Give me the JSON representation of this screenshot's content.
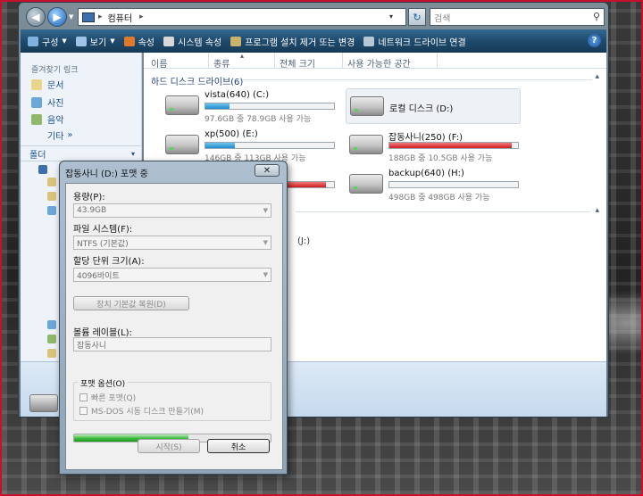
{
  "explorer": {
    "address": {
      "crumb": "컴퓨터",
      "sep": "▸",
      "crumbsep": "▸",
      "dropdown": "▾"
    },
    "search_placeholder": "검색",
    "toolbar": [
      {
        "label": "구성",
        "icon": "organize-icon",
        "dropdown": true,
        "color": "#7fb2e0"
      },
      {
        "label": "보기",
        "icon": "views-icon",
        "dropdown": true,
        "color": "#9fc3e6"
      },
      {
        "label": "속성",
        "icon": "checkmark-icon",
        "dropdown": false,
        "color": "#e07a2a"
      },
      {
        "label": "시스템 속성",
        "icon": "system-icon",
        "dropdown": false,
        "color": "#d8d8d8"
      },
      {
        "label": "프로그램 설치 제거 또는 변경",
        "icon": "programs-icon",
        "dropdown": false,
        "color": "#c9b36a"
      },
      {
        "label": "네트워크 드라이브 연결",
        "icon": "network-drive-icon",
        "dropdown": false,
        "color": "#b9c7d4"
      }
    ],
    "help": "?",
    "sidebar": {
      "favorites_title": "즐겨찾기 링크",
      "favorites": [
        {
          "label": "문서",
          "icon": "documents-icon",
          "color": "#e8d48a"
        },
        {
          "label": "사진",
          "icon": "pictures-icon",
          "color": "#6aa7d8"
        },
        {
          "label": "음악",
          "icon": "music-icon",
          "color": "#8fb86a"
        }
      ],
      "more": "기타",
      "more_arrow": "»",
      "folders_label": "폴더",
      "folders_arrow": "▾"
    },
    "columns": [
      "이름",
      "종류",
      "전체 크기",
      "사용 가능한 공간"
    ],
    "group_title": "하드 디스크 드라이브(6)",
    "drives": [
      {
        "name": "vista(640) (C:)",
        "info": "97.6GB 중 78.9GB 사용 가능",
        "fill": 0.19,
        "critical": false,
        "selected": false
      },
      {
        "name": "로컬 디스크 (D:)",
        "info": "",
        "fill": null,
        "critical": false,
        "selected": true
      },
      {
        "name": "xp(500) (E:)",
        "info": "146GB 중 113GB 사용 가능",
        "fill": 0.23,
        "critical": false,
        "selected": false
      },
      {
        "name": "잡동사니(250) (F:)",
        "info": "188GB 중 10.5GB 사용 가능",
        "fill": 0.95,
        "critical": true,
        "selected": false
      },
      {
        "name": "",
        "info": "",
        "fill": 0.94,
        "critical": true,
        "selected": false
      },
      {
        "name": "backup(640) (H:)",
        "info": "498GB 중 498GB 사용 가능",
        "fill": 0.0,
        "critical": false,
        "selected": false
      }
    ],
    "j_label": "(J:)",
    "caret_up": "▴"
  },
  "dialog": {
    "title": "잡동사니 (D:) 포맷 중",
    "close": "✕",
    "capacity_label": "용량(P):",
    "capacity_value": "43.9GB",
    "filesystem_label": "파일 시스템(F):",
    "filesystem_value": "NTFS (기본값)",
    "allocation_label": "할당 단위 크기(A):",
    "allocation_value": "4096바이트",
    "restore_button": "장치 기본값 복원(D)",
    "volume_label_label": "볼륨 레이블(L):",
    "volume_label_value": "잡동사니",
    "format_options_label": "포맷 옵션(O)",
    "quick_format": "빠른 포맷(Q)",
    "msdos_disk": "MS-DOS 시동 디스크 만들기(M)",
    "progress": 0.58,
    "start_button": "시작(S)",
    "close_button": "취소"
  }
}
